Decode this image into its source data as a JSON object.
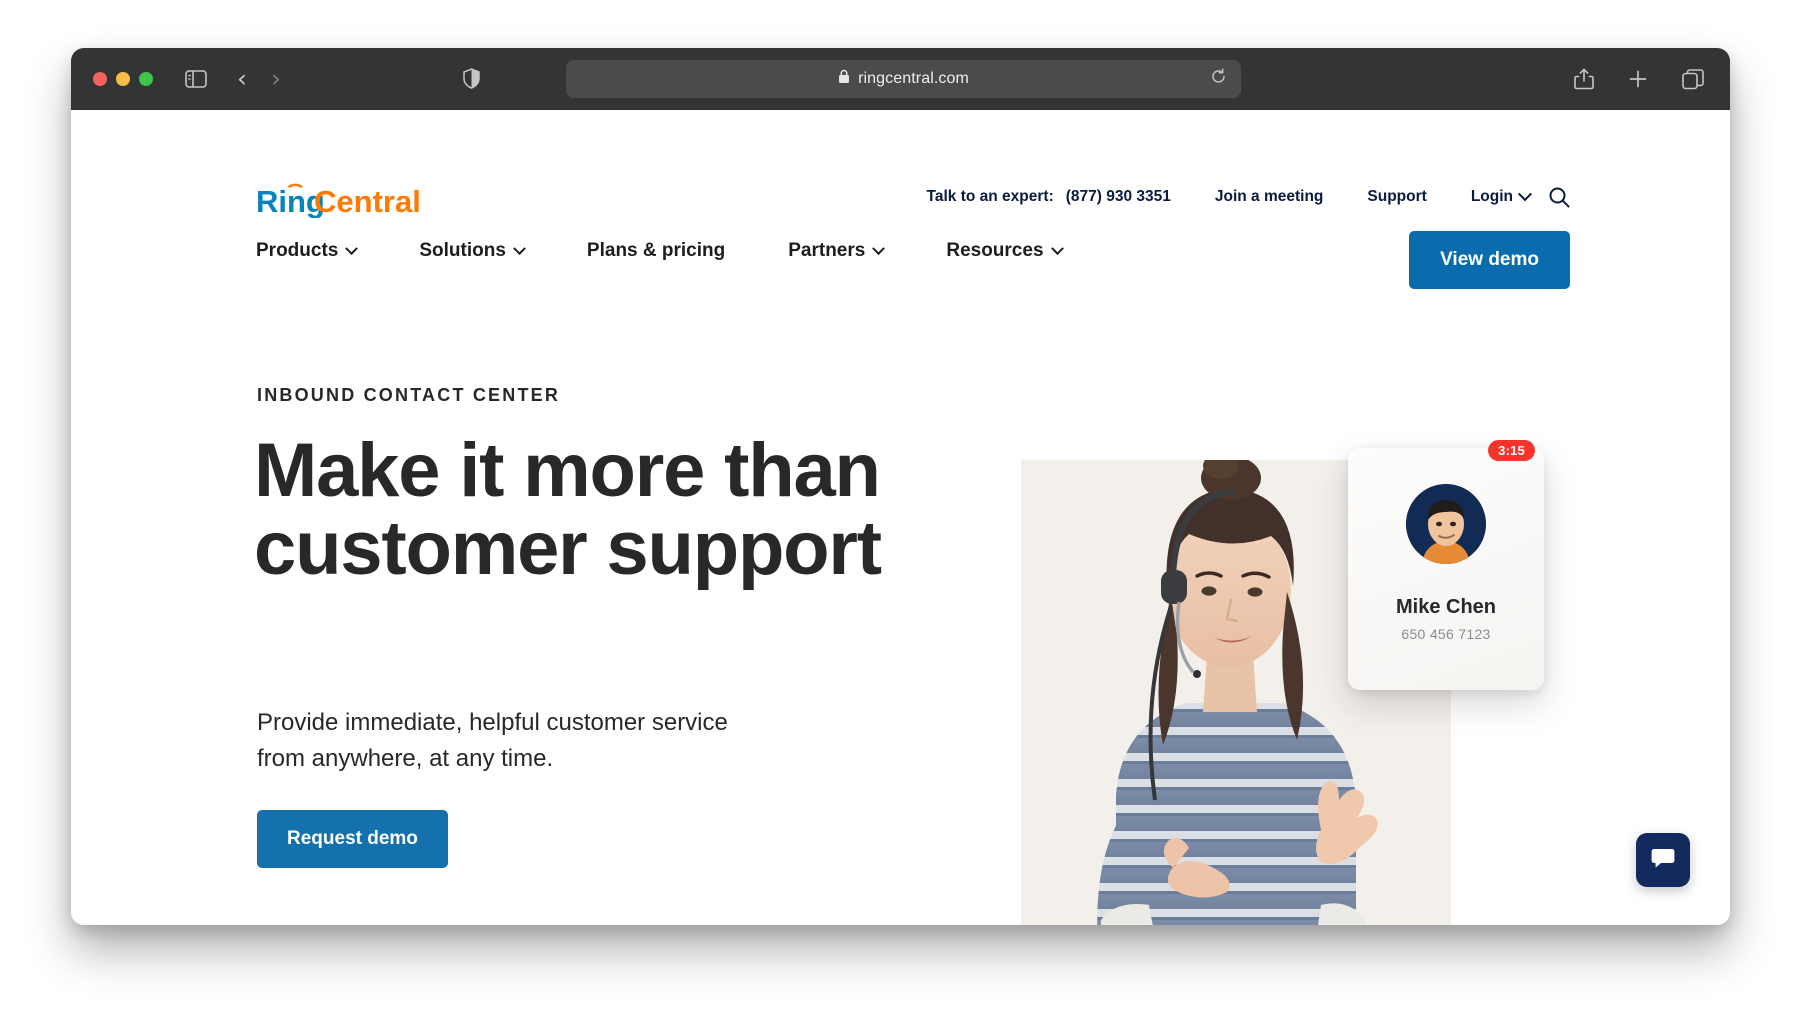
{
  "browser": {
    "name": "safari",
    "url": "ringcentral.com",
    "secure_icon": "lock-icon",
    "reload_icon": "reload-icon",
    "sidebar_icon": "sidebar-toggle-icon",
    "back_icon": "back-chevron-icon",
    "forward_icon": "forward-chevron-icon",
    "shield_icon": "privacy-shield-icon",
    "share_icon": "share-icon",
    "new_tab_icon": "plus-icon",
    "tabs_icon": "tab-overview-icon",
    "traffic_lights": [
      "close",
      "minimize",
      "zoom"
    ]
  },
  "site": {
    "logo": {
      "part1": "Ring",
      "part2": "Central",
      "part1_color": "#0684bc",
      "part2_color": "#ff7a00"
    },
    "utility_nav": {
      "expert_label": "Talk to an expert:",
      "expert_phone": "(877) 930 3351",
      "join_meeting": "Join a meeting",
      "support": "Support",
      "login": "Login",
      "search_icon": "search-icon"
    },
    "main_nav": [
      {
        "label": "Products",
        "has_dropdown": true
      },
      {
        "label": "Solutions",
        "has_dropdown": true
      },
      {
        "label": "Plans & pricing",
        "has_dropdown": false
      },
      {
        "label": "Partners",
        "has_dropdown": true
      },
      {
        "label": "Resources",
        "has_dropdown": true
      }
    ],
    "view_demo": "View demo",
    "accent_blue": "#0a6bad"
  },
  "hero": {
    "eyebrow": "INBOUND CONTACT CENTER",
    "headline": "Make it more than customer support",
    "subhead": "Provide immediate, helpful customer service from anywhere, at any time.",
    "cta": "Request demo",
    "image_alt": "agent-with-headset-photo"
  },
  "contact_card": {
    "timer": "3:15",
    "timer_color": "#f5352b",
    "name": "Mike Chen",
    "phone": "650 456 7123",
    "avatar_alt": "mike-chen-avatar"
  },
  "chat_widget": {
    "icon": "chat-bubble-icon",
    "color": "#132a5e"
  }
}
